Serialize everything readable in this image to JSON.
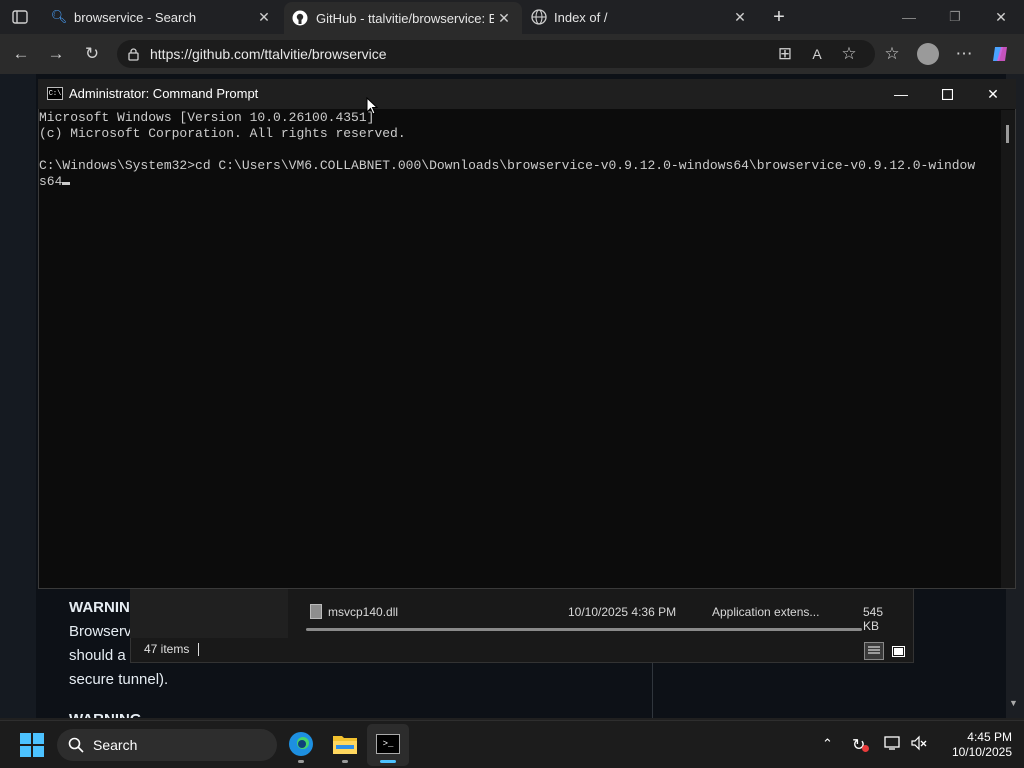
{
  "browser": {
    "tabs": [
      {
        "title": "browservice - Search"
      },
      {
        "title": "GitHub - ttalvitie/browservice: Bro"
      },
      {
        "title": "Index of /"
      }
    ],
    "address": "https://github.com/ttalvitie/browservice"
  },
  "page": {
    "warning_label": "WARNING",
    "warning_line1": "Browserv",
    "warning_line2": "should a",
    "warning_line3": "secure tunnel).",
    "warning_partial": "WARNING"
  },
  "explorer": {
    "file_name": "msvcp140.dll",
    "file_date": "10/10/2025 4:36 PM",
    "file_type": "Application extens...",
    "file_size": "545 KB",
    "item_count": "47 items"
  },
  "cmd": {
    "title": "Administrator: Command Prompt",
    "lines": [
      "Microsoft Windows [Version 10.0.26100.4351]",
      "(c) Microsoft Corporation. All rights reserved.",
      "",
      "C:\\Windows\\System32>cd C:\\Users\\VM6.COLLABNET.000\\Downloads\\browservice-v0.9.12.0-windows64\\browservice-v0.9.12.0-window",
      "s64"
    ]
  },
  "taskbar": {
    "search_placeholder": "Search",
    "time": "4:45 PM",
    "date": "10/10/2025"
  },
  "colors": {
    "accent_edge": "#0078d4",
    "cmd_background": "#0c0c0c",
    "page_background": "#0d1117"
  }
}
